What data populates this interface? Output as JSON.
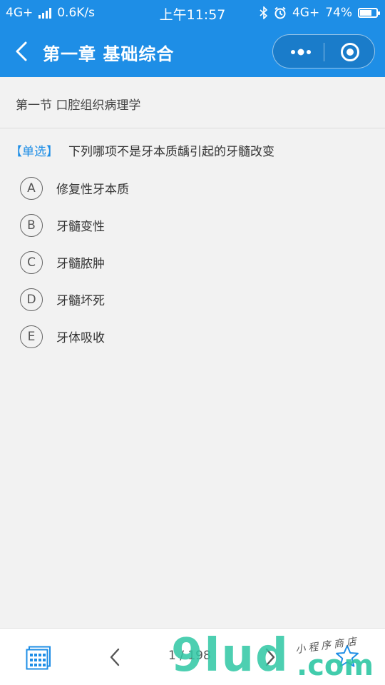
{
  "status_bar": {
    "network": "4G+",
    "speed": "0.6K/s",
    "time": "上午11:57",
    "network_right": "4G+",
    "battery": "74%",
    "battery_level": 0.74
  },
  "nav": {
    "title": "第一章 基础综合"
  },
  "section": {
    "title": "第一节 口腔组织病理学"
  },
  "question": {
    "type": "【单选】",
    "text": "下列哪项不是牙本质龋引起的牙髓改变",
    "options": [
      {
        "letter": "A",
        "text": "修复性牙本质"
      },
      {
        "letter": "B",
        "text": "牙髓变性"
      },
      {
        "letter": "C",
        "text": "牙髓脓肿"
      },
      {
        "letter": "D",
        "text": "牙髓坏死"
      },
      {
        "letter": "E",
        "text": "牙体吸收"
      }
    ]
  },
  "footer": {
    "page_indicator": "1 / 198"
  },
  "watermark": {
    "brand": "9lud",
    "domain": ".com",
    "tagline": "小程序商店"
  },
  "colors": {
    "primary": "#1e8ee6",
    "background": "#f2f2f2",
    "watermark": "#2ec7a4"
  }
}
